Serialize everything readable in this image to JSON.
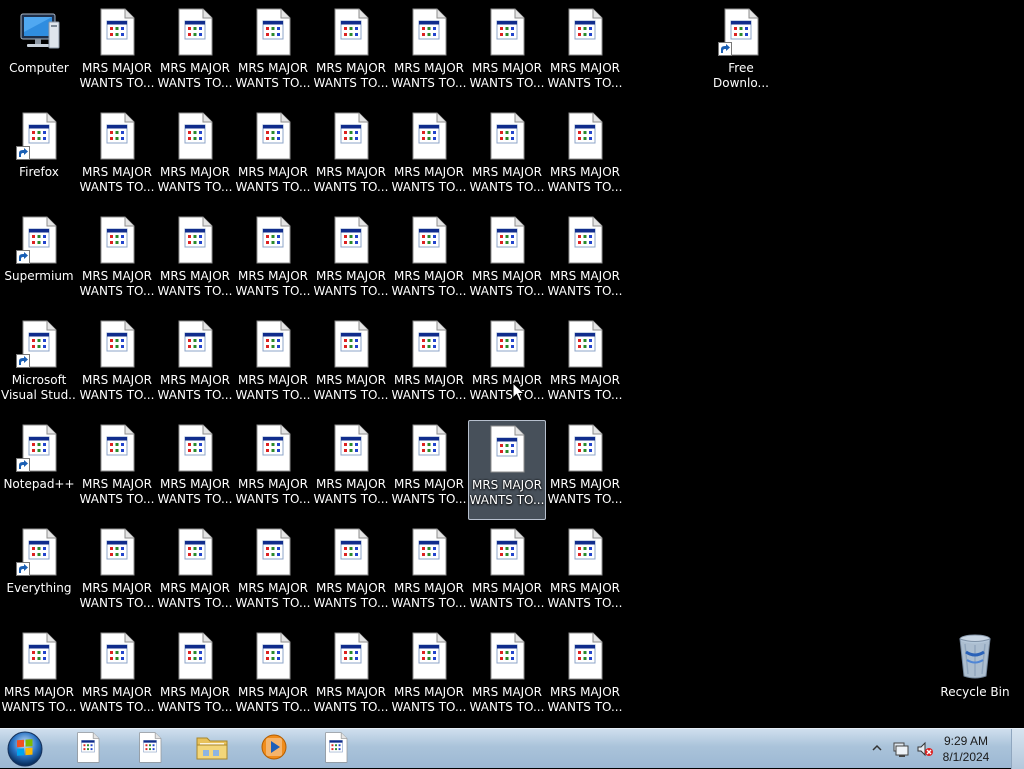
{
  "desktop": {
    "system_icons": [
      {
        "label_lines": [
          "Computer"
        ],
        "icon": "computer-icon"
      },
      {
        "label_lines": [
          "Firefox"
        ],
        "icon": "app-shortcut-icon"
      },
      {
        "label_lines": [
          "Supermium"
        ],
        "icon": "app-shortcut-icon"
      },
      {
        "label_lines": [
          "Microsoft",
          "Visual Stud..."
        ],
        "icon": "app-shortcut-icon"
      },
      {
        "label_lines": [
          "Notepad++"
        ],
        "icon": "app-shortcut-icon"
      },
      {
        "label_lines": [
          "Everything"
        ],
        "icon": "app-shortcut-icon"
      },
      {
        "label_lines": [
          "MRS MAJOR",
          "WANTS TO..."
        ],
        "icon": "program-file-icon"
      }
    ],
    "grid_file": {
      "label_lines": [
        "MRS MAJOR",
        "WANTS TO..."
      ],
      "icon": "program-file-icon"
    },
    "grid_columns": 7,
    "grid_rows": 7,
    "selected_item": {
      "row": 4,
      "col": 6
    },
    "free_download": {
      "label_lines": [
        "Free",
        "Downlo..."
      ],
      "icon": "app-shortcut-icon"
    },
    "recycle_bin": {
      "label_lines": [
        "Recycle Bin"
      ],
      "icon": "recycle-bin-icon"
    }
  },
  "taskbar": {
    "start_button": "windows-orb-icon",
    "pinned": [
      {
        "name": "program-file-icon"
      },
      {
        "name": "program-file-icon"
      },
      {
        "name": "folder-icon"
      },
      {
        "name": "media-player-icon"
      },
      {
        "name": "program-file-icon"
      }
    ],
    "tray": {
      "icons": [
        "show-hidden-icons-chevron",
        "network-icon",
        "volume-muted-icon"
      ],
      "time": "9:29 AM",
      "date": "8/1/2024"
    }
  },
  "colors": {
    "desktop_background": "#000000",
    "taskbar": "#aac3da",
    "selection": "#aabed7"
  }
}
